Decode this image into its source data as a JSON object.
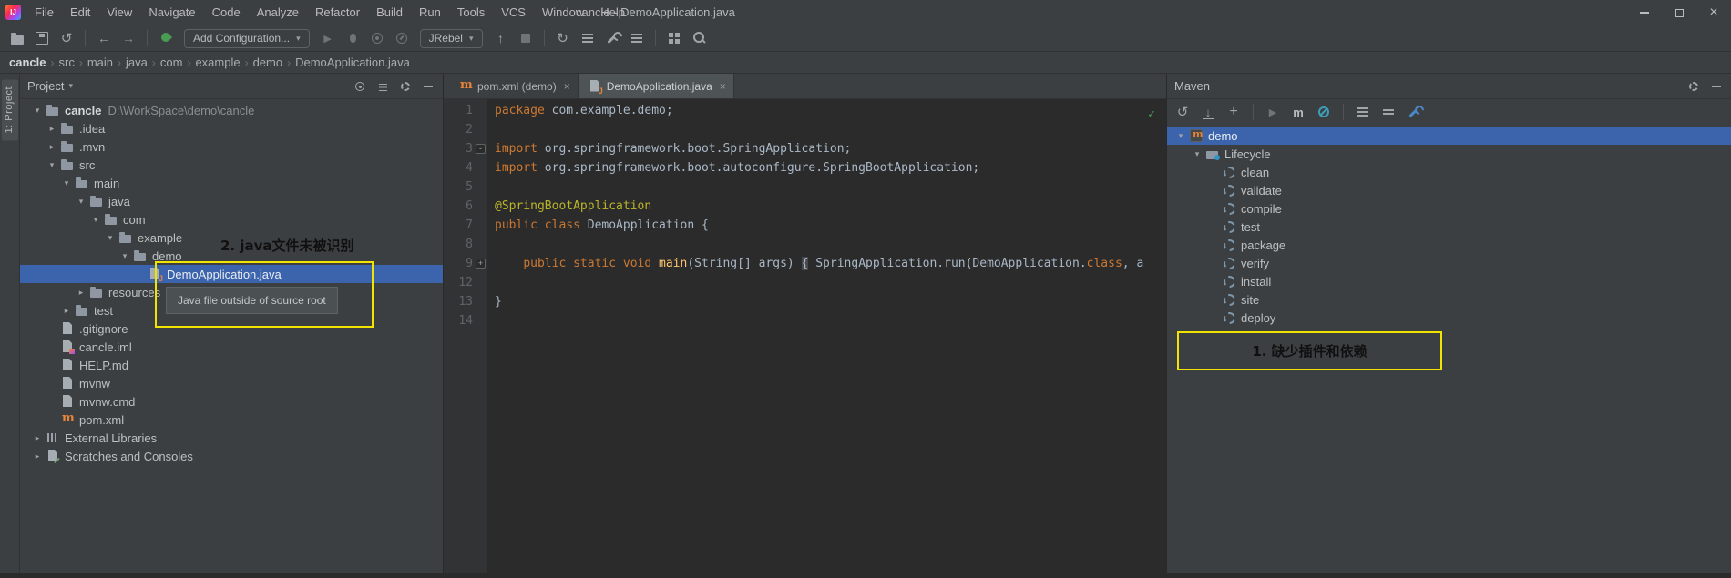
{
  "colors": {
    "selection": "#3c64ad",
    "annotation": "#f0e400",
    "keyword": "#cc7832",
    "plain": "#a9b7c6",
    "code_annotation": "#bbb529",
    "method": "#ffc66d",
    "ok_green": "#499c54",
    "maven_orange": "#e8833a"
  },
  "titlebar": {
    "title": "cancle - DemoApplication.java",
    "menu_items": [
      "File",
      "Edit",
      "View",
      "Navigate",
      "Code",
      "Analyze",
      "Refactor",
      "Build",
      "Run",
      "Tools",
      "VCS",
      "Window",
      "Help"
    ],
    "window_controls": [
      "minimize",
      "maximize",
      "close"
    ]
  },
  "toolbar": {
    "items": [
      {
        "kind": "icon",
        "name": "open"
      },
      {
        "kind": "icon",
        "name": "save"
      },
      {
        "kind": "icon",
        "name": "sync"
      },
      {
        "kind": "divider"
      },
      {
        "kind": "icon",
        "name": "back"
      },
      {
        "kind": "icon",
        "name": "forward"
      },
      {
        "kind": "divider"
      },
      {
        "kind": "icon",
        "name": "jrebel-enable"
      },
      {
        "kind": "pill",
        "name": "add-configuration",
        "label": "Add Configuration...",
        "caret": true
      },
      {
        "kind": "icon",
        "name": "run"
      },
      {
        "kind": "icon",
        "name": "debug"
      },
      {
        "kind": "icon",
        "name": "coverage"
      },
      {
        "kind": "icon",
        "name": "profiler"
      },
      {
        "kind": "pill",
        "name": "jrebel",
        "label": "JRebel",
        "caret": true
      },
      {
        "kind": "icon",
        "name": "attach"
      },
      {
        "kind": "icon",
        "name": "stop"
      },
      {
        "kind": "divider"
      },
      {
        "kind": "icon",
        "name": "restart"
      },
      {
        "kind": "icon",
        "name": "sliders"
      },
      {
        "kind": "icon",
        "name": "wrench"
      },
      {
        "kind": "icon",
        "name": "structure"
      },
      {
        "kind": "divider"
      },
      {
        "kind": "icon",
        "name": "layout"
      },
      {
        "kind": "icon",
        "name": "search"
      }
    ]
  },
  "breadcrumbs": {
    "items": [
      "cancle",
      "src",
      "main",
      "java",
      "com",
      "example",
      "demo",
      "DemoApplication.java"
    ]
  },
  "left_strip": {
    "project_tab_label": "1: Project"
  },
  "project_panel": {
    "header_title": "Project",
    "header_icons": [
      "locate",
      "collapse-panel",
      "settings",
      "hide"
    ],
    "tooltip": "Java file outside of source root",
    "tree": [
      {
        "label": "cancle",
        "path_suffix": "D:\\WorkSpace\\demo\\cancle",
        "depth": 0,
        "icon": "folder",
        "state": "expanded",
        "bold": true
      },
      {
        "label": ".idea",
        "depth": 1,
        "icon": "folder",
        "state": "collapsed"
      },
      {
        "label": ".mvn",
        "depth": 1,
        "icon": "folder",
        "state": "collapsed"
      },
      {
        "label": "src",
        "depth": 1,
        "icon": "folder",
        "state": "expanded"
      },
      {
        "label": "main",
        "depth": 2,
        "icon": "folder",
        "state": "expanded"
      },
      {
        "label": "java",
        "depth": 3,
        "icon": "folder",
        "state": "expanded"
      },
      {
        "label": "com",
        "depth": 4,
        "icon": "folder",
        "state": "expanded"
      },
      {
        "label": "example",
        "depth": 5,
        "icon": "folder",
        "state": "expanded"
      },
      {
        "label": "demo",
        "depth": 6,
        "icon": "folder",
        "state": "expanded"
      },
      {
        "label": "DemoApplication.java",
        "depth": 7,
        "icon": "java-file",
        "state": "leaf",
        "selected": true
      },
      {
        "label": "resources",
        "depth": 3,
        "icon": "folder",
        "state": "collapsed"
      },
      {
        "label": "test",
        "depth": 2,
        "icon": "folder",
        "state": "collapsed"
      },
      {
        "label": ".gitignore",
        "depth": 1,
        "icon": "text-file",
        "state": "leaf"
      },
      {
        "label": "cancle.iml",
        "depth": 1,
        "icon": "iml-file",
        "state": "leaf"
      },
      {
        "label": "HELP.md",
        "depth": 1,
        "icon": "md-file",
        "state": "leaf"
      },
      {
        "label": "mvnw",
        "depth": 1,
        "icon": "script-file",
        "state": "leaf"
      },
      {
        "label": "mvnw.cmd",
        "depth": 1,
        "icon": "cmd-file",
        "state": "leaf"
      },
      {
        "label": "pom.xml",
        "depth": 1,
        "icon": "maven-file",
        "state": "leaf"
      },
      {
        "label": "External Libraries",
        "depth": 0,
        "icon": "libraries",
        "state": "collapsed"
      },
      {
        "label": "Scratches and Consoles",
        "depth": 0,
        "icon": "scratches",
        "state": "collapsed"
      }
    ]
  },
  "editor": {
    "tabs": [
      {
        "label": "pom.xml (demo)",
        "icon": "maven-file",
        "active": false
      },
      {
        "label": "DemoApplication.java",
        "icon": "java-file",
        "active": true
      }
    ],
    "status_check": "✓",
    "lines": [
      {
        "num": "1",
        "segs": [
          {
            "t": "package ",
            "c": "kw"
          },
          {
            "t": "com.example.demo;",
            "c": "pl"
          }
        ]
      },
      {
        "num": "2",
        "segs": []
      },
      {
        "num": "3",
        "fold": "-",
        "segs": [
          {
            "t": "import ",
            "c": "kw"
          },
          {
            "t": "org.springframework.boot.SpringApplication;",
            "c": "pl"
          }
        ]
      },
      {
        "num": "4",
        "segs": [
          {
            "t": "import ",
            "c": "kw"
          },
          {
            "t": "org.springframework.boot.autoconfigure.SpringBootApplication;",
            "c": "pl"
          }
        ]
      },
      {
        "num": "5",
        "segs": []
      },
      {
        "num": "6",
        "segs": [
          {
            "t": "@SpringBootApplication",
            "c": "ann"
          }
        ]
      },
      {
        "num": "7",
        "segs": [
          {
            "t": "public class ",
            "c": "kw"
          },
          {
            "t": "DemoApplication {",
            "c": "pl"
          }
        ]
      },
      {
        "num": "8",
        "segs": []
      },
      {
        "num": "9",
        "fold": "+",
        "segs": [
          {
            "t": "    ",
            "c": "pl"
          },
          {
            "t": "public static void ",
            "c": "kw"
          },
          {
            "t": "main",
            "c": "mtd"
          },
          {
            "t": "(String[] args) ",
            "c": "pl"
          },
          {
            "t": "{",
            "c": "brace"
          },
          {
            "t": " SpringApplication.run(DemoApplication.",
            "c": "pl"
          },
          {
            "t": "class",
            "c": "kw"
          },
          {
            "t": ", a",
            "c": "pl"
          }
        ]
      },
      {
        "num": "12",
        "segs": []
      },
      {
        "num": "13",
        "segs": [
          {
            "t": "}",
            "c": "pl"
          }
        ]
      },
      {
        "num": "14",
        "segs": []
      }
    ]
  },
  "maven_panel": {
    "header_title": "Maven",
    "header_icons": [
      "settings",
      "hide"
    ],
    "toolbar_items": [
      {
        "kind": "icon",
        "name": "refresh"
      },
      {
        "kind": "icon",
        "name": "download-sources"
      },
      {
        "kind": "icon",
        "name": "add"
      },
      {
        "kind": "divider"
      },
      {
        "kind": "icon",
        "name": "run-goal"
      },
      {
        "kind": "icon",
        "name": "execute-goal"
      },
      {
        "kind": "icon",
        "name": "skip-tests"
      },
      {
        "kind": "divider"
      },
      {
        "kind": "icon",
        "name": "expand-all"
      },
      {
        "kind": "icon",
        "name": "collapse-all"
      },
      {
        "kind": "icon",
        "name": "maven-settings"
      }
    ],
    "tree": [
      {
        "label": "demo",
        "depth": 0,
        "icon": "maven-project",
        "state": "expanded",
        "selected": true
      },
      {
        "label": "Lifecycle",
        "depth": 1,
        "icon": "lifecycle",
        "state": "expanded"
      },
      {
        "label": "clean",
        "depth": 2,
        "icon": "goal",
        "state": "leaf"
      },
      {
        "label": "validate",
        "depth": 2,
        "icon": "goal",
        "state": "leaf"
      },
      {
        "label": "compile",
        "depth": 2,
        "icon": "goal",
        "state": "leaf"
      },
      {
        "label": "test",
        "depth": 2,
        "icon": "goal",
        "state": "leaf"
      },
      {
        "label": "package",
        "depth": 2,
        "icon": "goal",
        "state": "leaf"
      },
      {
        "label": "verify",
        "depth": 2,
        "icon": "goal",
        "state": "leaf"
      },
      {
        "label": "install",
        "depth": 2,
        "icon": "goal",
        "state": "leaf"
      },
      {
        "label": "site",
        "depth": 2,
        "icon": "goal",
        "state": "leaf"
      },
      {
        "label": "deploy",
        "depth": 2,
        "icon": "goal",
        "state": "leaf"
      }
    ]
  },
  "annotations": {
    "note1": "1. 缺少插件和依赖",
    "note2": "2. java文件未被识别"
  }
}
